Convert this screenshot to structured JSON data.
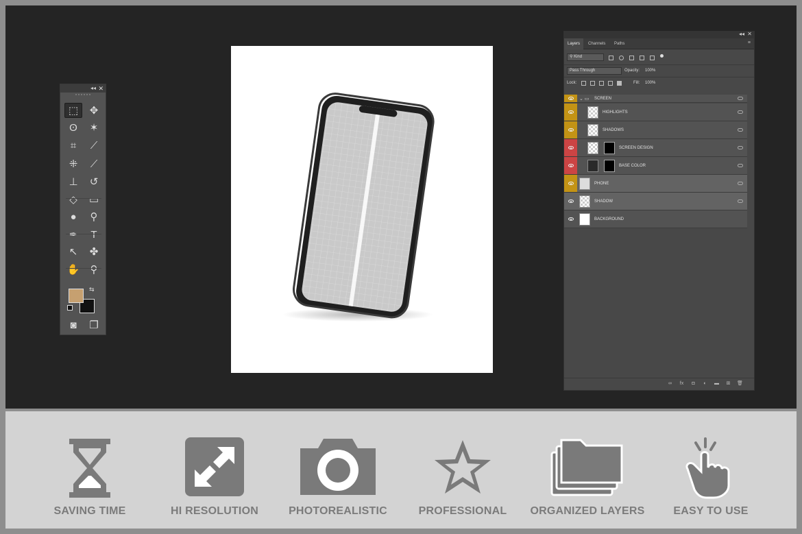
{
  "toolbox": {
    "tools": [
      {
        "name": "marquee-tool-icon",
        "glyph": "⬚"
      },
      {
        "name": "move-tool-icon",
        "glyph": "✥"
      },
      {
        "name": "lasso-tool-icon",
        "glyph": "ʘ"
      },
      {
        "name": "magic-wand-tool-icon",
        "glyph": "✶"
      },
      {
        "name": "crop-tool-icon",
        "glyph": "⌗"
      },
      {
        "name": "eyedropper-tool-icon",
        "glyph": "⟋"
      },
      {
        "name": "healing-brush-tool-icon",
        "glyph": "⁜"
      },
      {
        "name": "brush-tool-icon",
        "glyph": "⟋"
      },
      {
        "name": "clone-stamp-tool-icon",
        "glyph": "⊥"
      },
      {
        "name": "history-brush-tool-icon",
        "glyph": "↺"
      },
      {
        "name": "eraser-tool-icon",
        "glyph": "◇"
      },
      {
        "name": "gradient-tool-icon",
        "glyph": "▭"
      },
      {
        "name": "blur-tool-icon",
        "glyph": "●"
      },
      {
        "name": "dodge-tool-icon",
        "glyph": "⚲"
      },
      {
        "name": "pen-tool-icon",
        "glyph": "✒"
      },
      {
        "name": "type-tool-icon",
        "glyph": "T"
      },
      {
        "name": "path-selection-tool-icon",
        "glyph": "↖"
      },
      {
        "name": "shape-tool-icon",
        "glyph": "✤"
      },
      {
        "name": "hand-tool-icon",
        "glyph": "✋"
      },
      {
        "name": "zoom-tool-icon",
        "glyph": "⚲"
      },
      {
        "name": "quick-mask-icon",
        "glyph": "◙"
      },
      {
        "name": "screen-mode-icon",
        "glyph": "❐"
      }
    ],
    "foreground_color": "#c6a070",
    "background_color": "#111111"
  },
  "layers_panel": {
    "tabs": [
      "Layers",
      "Channels",
      "Paths"
    ],
    "filter_kind": "Kind",
    "blend_mode": "Pass Through",
    "opacity_label": "Opacity:",
    "opacity_value": "100%",
    "lock_label": "Lock:",
    "fill_label": "Fill:",
    "fill_value": "100%",
    "layers": [
      {
        "name": "SCREEN",
        "color": "#c39315",
        "kind": "group"
      },
      {
        "name": "HIGHLIGHTS",
        "color": "#c39315",
        "kind": "layer-mask"
      },
      {
        "name": "SHADOWS",
        "color": "#c39315",
        "kind": "layer"
      },
      {
        "name": "SCREEN DESIGN",
        "color": "#cc4444",
        "kind": "smart"
      },
      {
        "name": "BASE COLOR",
        "color": "#cc4444",
        "kind": "smart-dark"
      },
      {
        "name": "PHONE",
        "color": "#c39315",
        "kind": "layer-phone"
      },
      {
        "name": "SHADOW",
        "color": "",
        "kind": "layer"
      },
      {
        "name": "BACKGROUND",
        "color": "",
        "kind": "bg"
      }
    ]
  },
  "features": [
    {
      "label": "SAVING TIME",
      "icon": "hourglass-icon"
    },
    {
      "label": "HI RESOLUTION",
      "icon": "expand-arrows-icon"
    },
    {
      "label": "PHOTOREALISTIC",
      "icon": "camera-icon"
    },
    {
      "label": "PROFESSIONAL",
      "icon": "star-icon"
    },
    {
      "label": "ORGANIZED LAYERS",
      "icon": "folders-icon"
    },
    {
      "label": "EASY TO USE",
      "icon": "tap-hand-icon"
    }
  ]
}
